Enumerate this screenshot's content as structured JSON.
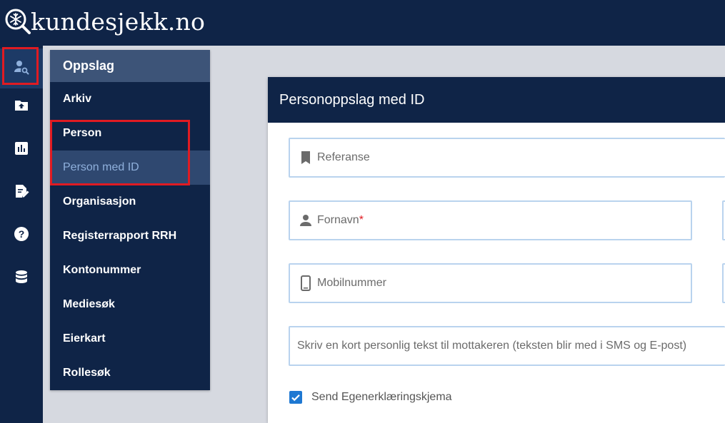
{
  "app": {
    "logo_text": "kundesjekk.no"
  },
  "rail": {
    "items": [
      {
        "icon": "person-search-icon",
        "active": true
      },
      {
        "icon": "folder-upload-icon",
        "active": false
      },
      {
        "icon": "bar-chart-icon",
        "active": false
      },
      {
        "icon": "edit-document-icon",
        "active": false
      },
      {
        "icon": "help-icon",
        "active": false
      },
      {
        "icon": "database-icon",
        "active": false
      }
    ]
  },
  "submenu": {
    "header": "Oppslag",
    "items": [
      {
        "label": "Arkiv"
      },
      {
        "label": "Person"
      },
      {
        "label": "Person med ID",
        "selected": true
      },
      {
        "label": "Organisasjon"
      },
      {
        "label": "Registerrapport RRH"
      },
      {
        "label": "Kontonummer"
      },
      {
        "label": "Mediesøk"
      },
      {
        "label": "Eierkart"
      },
      {
        "label": "Rollesøk"
      }
    ]
  },
  "main": {
    "title": "Personoppslag med ID",
    "fields": {
      "reference": {
        "placeholder": "Referanse",
        "icon": "bookmark-icon"
      },
      "first_name": {
        "placeholder": "Fornavn",
        "required_mark": "*",
        "icon": "person-icon"
      },
      "mobile": {
        "placeholder": "Mobilnummer",
        "icon": "smartphone-icon"
      },
      "message": {
        "placeholder": "Skriv en kort personlig tekst til mottakeren (teksten blir med i SMS og E-post)"
      }
    },
    "send_form": {
      "label": "Send Egenerklæringskjema",
      "checked": true
    }
  },
  "colors": {
    "navy": "#0f2447",
    "highlight": "#e01b22",
    "checkbox": "#1e78d2",
    "field_border": "#b9d3ee"
  }
}
